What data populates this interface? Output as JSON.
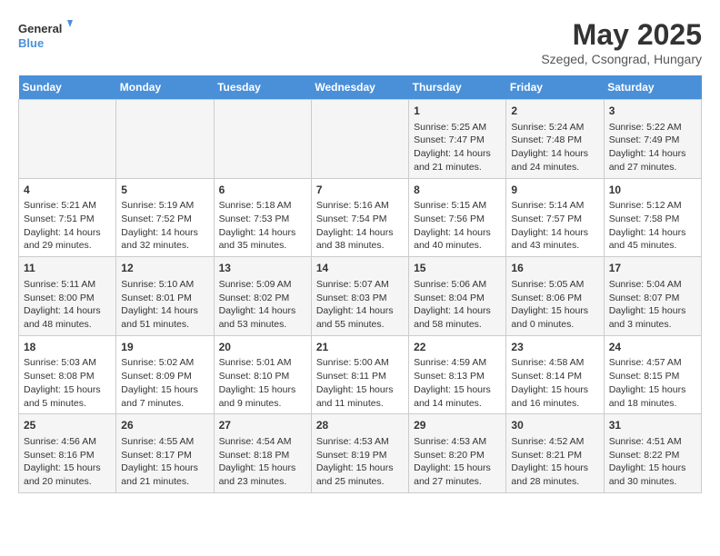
{
  "logo": {
    "line1": "General",
    "line2": "Blue"
  },
  "title": "May 2025",
  "location": "Szeged, Csongrad, Hungary",
  "days_of_week": [
    "Sunday",
    "Monday",
    "Tuesday",
    "Wednesday",
    "Thursday",
    "Friday",
    "Saturday"
  ],
  "weeks": [
    [
      {
        "num": "",
        "detail": ""
      },
      {
        "num": "",
        "detail": ""
      },
      {
        "num": "",
        "detail": ""
      },
      {
        "num": "",
        "detail": ""
      },
      {
        "num": "1",
        "detail": "Sunrise: 5:25 AM\nSunset: 7:47 PM\nDaylight: 14 hours\nand 21 minutes."
      },
      {
        "num": "2",
        "detail": "Sunrise: 5:24 AM\nSunset: 7:48 PM\nDaylight: 14 hours\nand 24 minutes."
      },
      {
        "num": "3",
        "detail": "Sunrise: 5:22 AM\nSunset: 7:49 PM\nDaylight: 14 hours\nand 27 minutes."
      }
    ],
    [
      {
        "num": "4",
        "detail": "Sunrise: 5:21 AM\nSunset: 7:51 PM\nDaylight: 14 hours\nand 29 minutes."
      },
      {
        "num": "5",
        "detail": "Sunrise: 5:19 AM\nSunset: 7:52 PM\nDaylight: 14 hours\nand 32 minutes."
      },
      {
        "num": "6",
        "detail": "Sunrise: 5:18 AM\nSunset: 7:53 PM\nDaylight: 14 hours\nand 35 minutes."
      },
      {
        "num": "7",
        "detail": "Sunrise: 5:16 AM\nSunset: 7:54 PM\nDaylight: 14 hours\nand 38 minutes."
      },
      {
        "num": "8",
        "detail": "Sunrise: 5:15 AM\nSunset: 7:56 PM\nDaylight: 14 hours\nand 40 minutes."
      },
      {
        "num": "9",
        "detail": "Sunrise: 5:14 AM\nSunset: 7:57 PM\nDaylight: 14 hours\nand 43 minutes."
      },
      {
        "num": "10",
        "detail": "Sunrise: 5:12 AM\nSunset: 7:58 PM\nDaylight: 14 hours\nand 45 minutes."
      }
    ],
    [
      {
        "num": "11",
        "detail": "Sunrise: 5:11 AM\nSunset: 8:00 PM\nDaylight: 14 hours\nand 48 minutes."
      },
      {
        "num": "12",
        "detail": "Sunrise: 5:10 AM\nSunset: 8:01 PM\nDaylight: 14 hours\nand 51 minutes."
      },
      {
        "num": "13",
        "detail": "Sunrise: 5:09 AM\nSunset: 8:02 PM\nDaylight: 14 hours\nand 53 minutes."
      },
      {
        "num": "14",
        "detail": "Sunrise: 5:07 AM\nSunset: 8:03 PM\nDaylight: 14 hours\nand 55 minutes."
      },
      {
        "num": "15",
        "detail": "Sunrise: 5:06 AM\nSunset: 8:04 PM\nDaylight: 14 hours\nand 58 minutes."
      },
      {
        "num": "16",
        "detail": "Sunrise: 5:05 AM\nSunset: 8:06 PM\nDaylight: 15 hours\nand 0 minutes."
      },
      {
        "num": "17",
        "detail": "Sunrise: 5:04 AM\nSunset: 8:07 PM\nDaylight: 15 hours\nand 3 minutes."
      }
    ],
    [
      {
        "num": "18",
        "detail": "Sunrise: 5:03 AM\nSunset: 8:08 PM\nDaylight: 15 hours\nand 5 minutes."
      },
      {
        "num": "19",
        "detail": "Sunrise: 5:02 AM\nSunset: 8:09 PM\nDaylight: 15 hours\nand 7 minutes."
      },
      {
        "num": "20",
        "detail": "Sunrise: 5:01 AM\nSunset: 8:10 PM\nDaylight: 15 hours\nand 9 minutes."
      },
      {
        "num": "21",
        "detail": "Sunrise: 5:00 AM\nSunset: 8:11 PM\nDaylight: 15 hours\nand 11 minutes."
      },
      {
        "num": "22",
        "detail": "Sunrise: 4:59 AM\nSunset: 8:13 PM\nDaylight: 15 hours\nand 14 minutes."
      },
      {
        "num": "23",
        "detail": "Sunrise: 4:58 AM\nSunset: 8:14 PM\nDaylight: 15 hours\nand 16 minutes."
      },
      {
        "num": "24",
        "detail": "Sunrise: 4:57 AM\nSunset: 8:15 PM\nDaylight: 15 hours\nand 18 minutes."
      }
    ],
    [
      {
        "num": "25",
        "detail": "Sunrise: 4:56 AM\nSunset: 8:16 PM\nDaylight: 15 hours\nand 20 minutes."
      },
      {
        "num": "26",
        "detail": "Sunrise: 4:55 AM\nSunset: 8:17 PM\nDaylight: 15 hours\nand 21 minutes."
      },
      {
        "num": "27",
        "detail": "Sunrise: 4:54 AM\nSunset: 8:18 PM\nDaylight: 15 hours\nand 23 minutes."
      },
      {
        "num": "28",
        "detail": "Sunrise: 4:53 AM\nSunset: 8:19 PM\nDaylight: 15 hours\nand 25 minutes."
      },
      {
        "num": "29",
        "detail": "Sunrise: 4:53 AM\nSunset: 8:20 PM\nDaylight: 15 hours\nand 27 minutes."
      },
      {
        "num": "30",
        "detail": "Sunrise: 4:52 AM\nSunset: 8:21 PM\nDaylight: 15 hours\nand 28 minutes."
      },
      {
        "num": "31",
        "detail": "Sunrise: 4:51 AM\nSunset: 8:22 PM\nDaylight: 15 hours\nand 30 minutes."
      }
    ]
  ]
}
